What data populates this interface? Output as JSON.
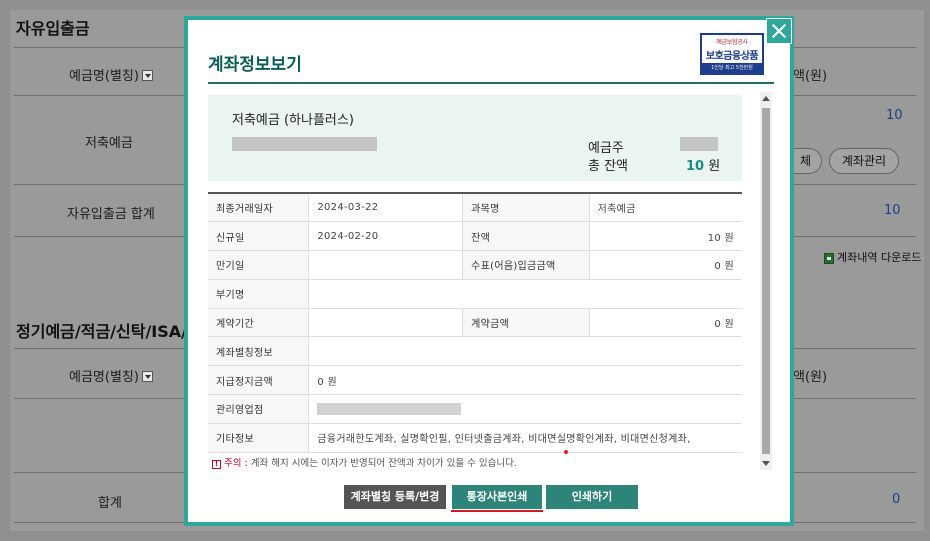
{
  "background": {
    "section1": {
      "title": "자유입출금",
      "col_account_name": "예금명(별칭)",
      "col_balance_partial": "액(원)",
      "account_label": "저축예금",
      "account_value": "10",
      "btn_partial": "체",
      "btn_manage": "계좌관리",
      "total_label": "자유입출금 합계",
      "total_value": "10",
      "download_label": "계좌내역 다운로드"
    },
    "section2": {
      "title": "정기예금/적금/신탁/ISA/",
      "col_account_name": "예금명(별칭)",
      "col_balance_partial": "액(원)",
      "total_label": "합계",
      "total_value": "0"
    }
  },
  "modal": {
    "title": "계좌정보보기",
    "badge": {
      "top": "예금보험공사",
      "main": "보호금융상품",
      "bottom": "1인당 최고 5천만원"
    },
    "summary": {
      "account_name": "저축예금 (하나플러스)",
      "holder_label": "예금주",
      "balance_label": "총 잔액",
      "balance_value": "10",
      "balance_unit": "원"
    },
    "info_rows": [
      {
        "label": "최종거래일자",
        "value": "2024-03-22",
        "label2": "과목명",
        "value2": "저축예금"
      },
      {
        "label": "신규일",
        "value": "2024-02-20",
        "label2": "잔액",
        "value2": "10 원"
      },
      {
        "label": "만기일",
        "value": "",
        "label2": "수표(어음)입금금액",
        "value2": "0 원"
      },
      {
        "label": "부기명",
        "value": ""
      },
      {
        "label": "계약기간",
        "value": "",
        "label2": "계약금액",
        "value2": "0 원"
      },
      {
        "label": "계좌별칭정보",
        "value": ""
      },
      {
        "label": "지급정지금액",
        "value": "0 원"
      },
      {
        "label": "관리영업점",
        "value": ""
      },
      {
        "label": "기타정보",
        "value": "금융거래한도계좌, 실명확인필, 인터넷출금계좌, 비대면실명확인계좌, 비대면신청계좌,"
      }
    ],
    "notice": {
      "prefix": "주의 :",
      "text": "계좌 해지 시에는 이자가 반영되어 잔액과 차이가 있을 수 있습니다."
    },
    "buttons": {
      "alias": "계좌별칭 등록/변경",
      "passbook": "통장사본인쇄",
      "print": "인쇄하기"
    }
  }
}
